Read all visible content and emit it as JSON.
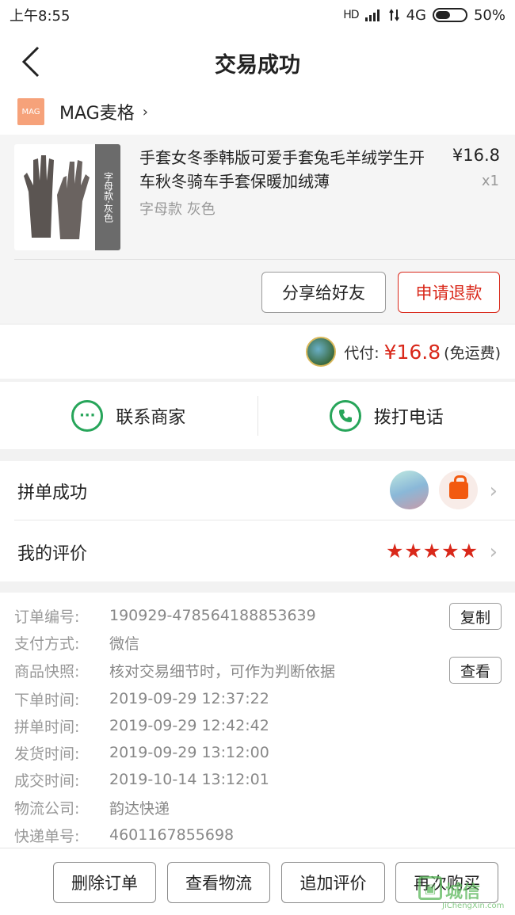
{
  "status_bar": {
    "time": "上午8:55",
    "signal": "HD",
    "network": "4G",
    "battery_text": "50%",
    "battery_level": 0.5
  },
  "navbar": {
    "title": "交易成功"
  },
  "shop": {
    "logo_text": "MAG",
    "name": "MAG麦格"
  },
  "product": {
    "title": "手套女冬季韩版可爱手套兔毛羊绒学生开车秋冬骑车手套保暖加绒薄",
    "variant": "字母款 灰色",
    "price": "¥16.8",
    "quantity": "x1",
    "thumb_tag": "字母款·灰色"
  },
  "actions": {
    "share_label": "分享给好友",
    "refund_label": "申请退款"
  },
  "payment": {
    "label": "代付:",
    "amount": "¥16.8",
    "note": "(免运费)"
  },
  "contact": {
    "merchant_label": "联系商家",
    "phone_label": "拨打电话"
  },
  "group": {
    "label": "拼单成功"
  },
  "review": {
    "label": "我的评价",
    "stars": 5
  },
  "details": {
    "order_no_label": "订单编号:",
    "order_no": "190929-478564188853639",
    "copy_label": "复制",
    "pay_method_label": "支付方式:",
    "pay_method": "微信",
    "snapshot_label": "商品快照:",
    "snapshot": "核对交易细节时，可作为判断依据",
    "view_label": "查看",
    "order_time_label": "下单时间:",
    "order_time": "2019-09-29 12:37:22",
    "group_time_label": "拼单时间:",
    "group_time": "2019-09-29 12:42:42",
    "ship_time_label": "发货时间:",
    "ship_time": "2019-09-29 13:12:00",
    "deal_time_label": "成交时间:",
    "deal_time": "2019-10-14 13:12:01",
    "logistics_label": "物流公司:",
    "logistics": "韵达快递",
    "tracking_label": "快递单号:",
    "tracking": "4601167855698"
  },
  "bottom": {
    "delete_label": "删除订单",
    "logistics_label": "查看物流",
    "append_label": "追加评价",
    "rebuy_label": "再次购买"
  },
  "watermark": {
    "text": "城信",
    "url": "JiChengXin.com"
  }
}
